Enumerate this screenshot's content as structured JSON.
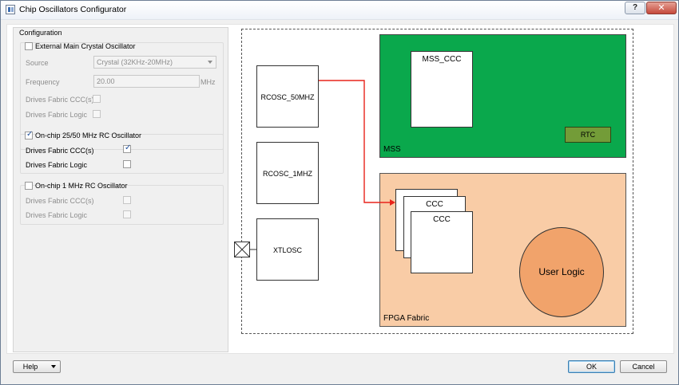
{
  "window": {
    "title": "Chip Oscillators Configurator",
    "help_glyph": "?",
    "close_glyph": "✕"
  },
  "config": {
    "title": "Configuration",
    "external": {
      "label": "External Main Crystal Oscillator",
      "checked": false,
      "source_label": "Source",
      "source_value": "Crystal (32KHz-20MHz)",
      "frequency_label": "Frequency",
      "frequency_value": "20.00",
      "frequency_unit": "MHz",
      "drives_ccc_label": "Drives Fabric CCC(s)",
      "drives_logic_label": "Drives Fabric Logic"
    },
    "rc2550": {
      "label": "On-chip 25/50 MHz RC Oscillator",
      "checked": true,
      "drives_ccc_label": "Drives Fabric CCC(s)",
      "drives_ccc_checked": true,
      "drives_logic_label": "Drives Fabric Logic",
      "drives_logic_checked": false
    },
    "rc1": {
      "label": "On-chip 1 MHz RC Oscillator",
      "checked": false,
      "drives_ccc_label": "Drives Fabric CCC(s)",
      "drives_logic_label": "Drives Fabric Logic"
    }
  },
  "diagram": {
    "osc1": "RCOSC_50MHZ",
    "osc2": "RCOSC_1MHZ",
    "osc3": "XTLOSC",
    "mss_label": "MSS",
    "mss_ccc": "MSS_CCC",
    "rtc": "RTC",
    "fabric_label": "FPGA Fabric",
    "ccc": "CCC",
    "user_logic": "User Logic",
    "colors": {
      "mss": "#0aa84c",
      "rtc": "#739c38",
      "fabric": "#f9cca6",
      "user_logic": "#f1a36b",
      "arrow": "#e8231b"
    }
  },
  "footer": {
    "help": "Help",
    "ok": "OK",
    "cancel": "Cancel"
  }
}
